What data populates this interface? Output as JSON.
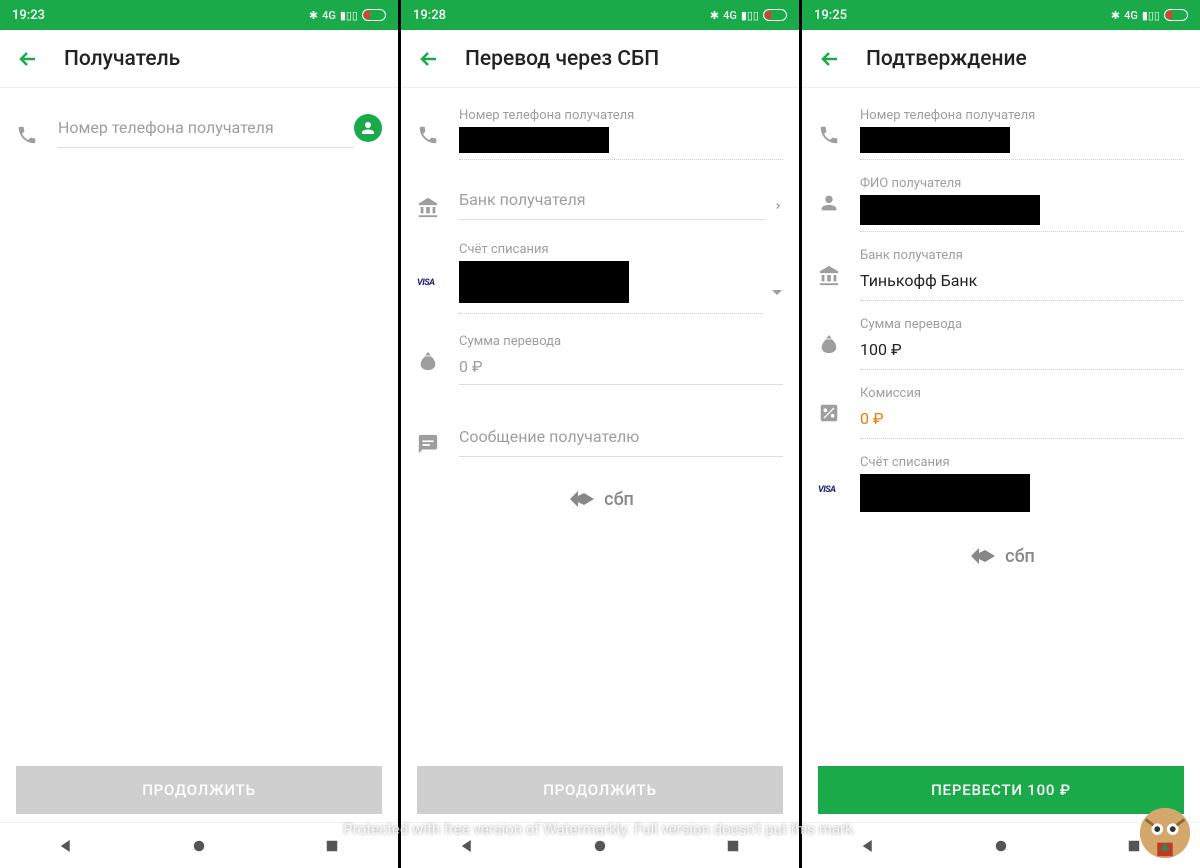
{
  "watermark": "Protected with free version of Watermarkly. Full version doesn't put this mark.",
  "screens": [
    {
      "time": "19:23",
      "title": "Получатель",
      "phone_placeholder": "Номер телефона получателя",
      "cta": "ПРОДОЛЖИТЬ",
      "cta_active": false
    },
    {
      "time": "19:28",
      "title": "Перевод через СБП",
      "phone_label": "Номер телефона получателя",
      "bank_placeholder": "Банк получателя",
      "account_label": "Счёт списания",
      "amount_label": "Сумма перевода",
      "amount_value": "0 ₽",
      "message_placeholder": "Сообщение получателю",
      "sbp": "сбп",
      "cta": "ПРОДОЛЖИТЬ",
      "cta_active": false
    },
    {
      "time": "19:25",
      "title": "Подтверждение",
      "phone_label": "Номер телефона получателя",
      "name_label": "ФИО получателя",
      "bank_label": "Банк получателя",
      "bank_value": "Тинькофф Банк",
      "amount_label": "Сумма перевода",
      "amount_value": "100 ₽",
      "fee_label": "Комиссия",
      "fee_value": "0 ₽",
      "account_label": "Счёт списания",
      "sbp": "сбп",
      "cta": "ПЕРЕВЕСТИ 100 ₽",
      "cta_active": true
    }
  ],
  "signal_label": "4G"
}
